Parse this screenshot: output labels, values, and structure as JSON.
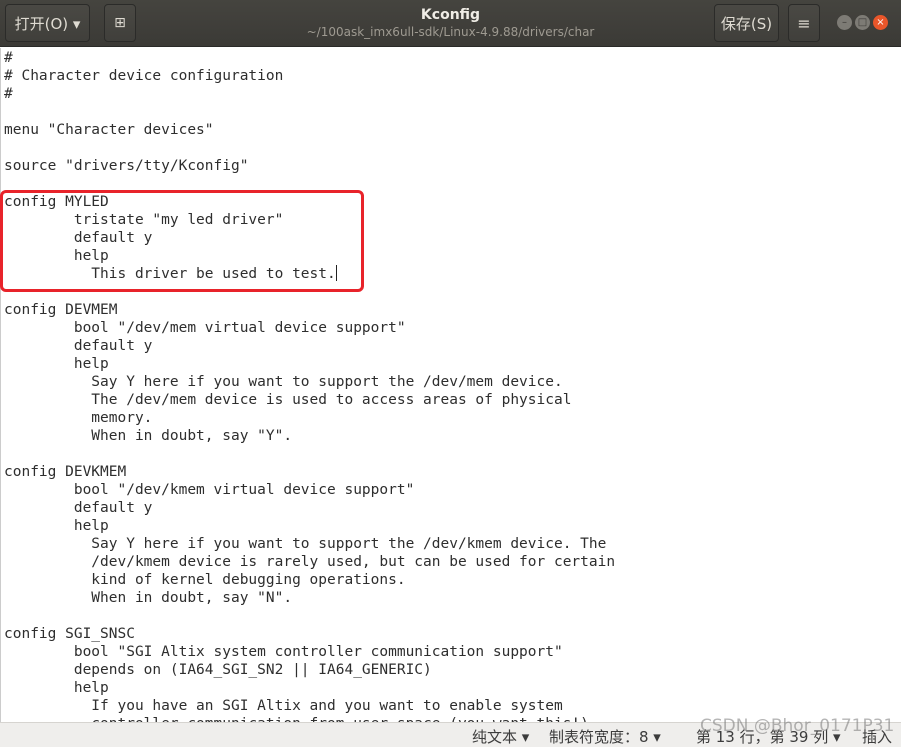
{
  "header": {
    "open_label": "打开(O) ▾",
    "title": "Kconfig",
    "path": "~/100ask_imx6ull-sdk/Linux-4.9.88/drivers/char",
    "save_label": "保存(S)",
    "menu_icon": "hamburger-icon",
    "new_tab_icon": "new-document-icon"
  },
  "editor": {
    "lines": [
      "#",
      "# Character device configuration",
      "#",
      "",
      "menu \"Character devices\"",
      "",
      "source \"drivers/tty/Kconfig\"",
      "",
      "config MYLED",
      "        tristate \"my led driver\"",
      "        default y",
      "        help",
      "          This driver be used to test.",
      "",
      "config DEVMEM",
      "        bool \"/dev/mem virtual device support\"",
      "        default y",
      "        help",
      "          Say Y here if you want to support the /dev/mem device.",
      "          The /dev/mem device is used to access areas of physical",
      "          memory.",
      "          When in doubt, say \"Y\".",
      "",
      "config DEVKMEM",
      "        bool \"/dev/kmem virtual device support\"",
      "        default y",
      "        help",
      "          Say Y here if you want to support the /dev/kmem device. The",
      "          /dev/kmem device is rarely used, but can be used for certain",
      "          kind of kernel debugging operations.",
      "          When in doubt, say \"N\".",
      "",
      "config SGI_SNSC",
      "        bool \"SGI Altix system controller communication support\"",
      "        depends on (IA64_SGI_SN2 || IA64_GENERIC)",
      "        help",
      "          If you have an SGI Altix and you want to enable system",
      "          controller communication from user space (you want this!),"
    ],
    "highlight_color": "#e8232a"
  },
  "status": {
    "language": "纯文本 ▾",
    "tab_width": "制表符宽度：8 ▾",
    "position": "第 13 行，第 39 列 ▾",
    "mode": "插入"
  },
  "watermark": "CSDN @Bhor_0171P31"
}
